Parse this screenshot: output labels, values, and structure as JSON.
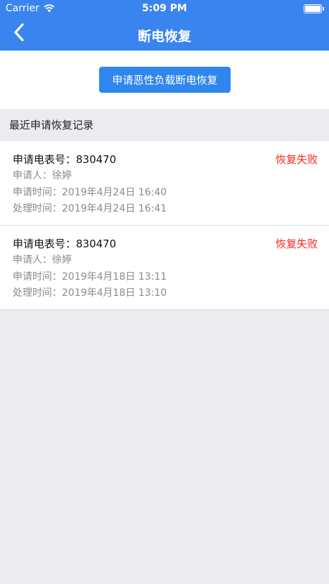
{
  "status_bar": {
    "carrier": "Carrier",
    "time": "5:09 PM"
  },
  "nav": {
    "title": "断电恢复"
  },
  "action": {
    "apply_label": "申请恶性负载断电恢复"
  },
  "section": {
    "title": "最近申请恢复记录"
  },
  "records": [
    {
      "meter": "申请电表号：830470",
      "applicant": "申请人：徐婷",
      "apply_time": "申请时间：2019年4月24日 16:40",
      "process_time": "处理时间：2019年4月24日 16:41",
      "status": "恢复失败"
    },
    {
      "meter": "申请电表号：830470",
      "applicant": "申请人：徐婷",
      "apply_time": "申请时间：2019年4月18日 13:11",
      "process_time": "处理时间：2019年4月18日 13:10",
      "status": "恢复失败"
    }
  ],
  "colors": {
    "header_blue": "#3a84f0",
    "button_blue": "#2f86ec",
    "fail_red": "#f2261f",
    "background": "#ebebf0"
  }
}
